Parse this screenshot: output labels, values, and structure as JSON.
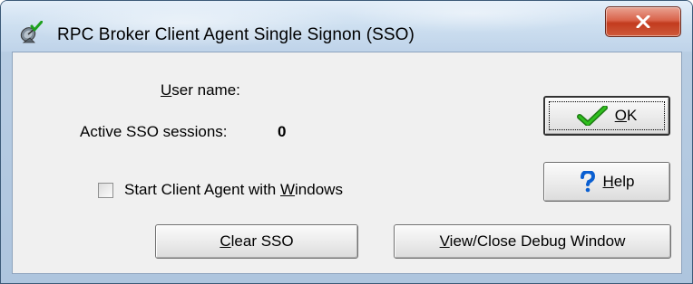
{
  "window": {
    "title": "RPC Broker Client Agent Single Signon (SSO)",
    "close_label": "x",
    "accent_close": "#c8432a"
  },
  "labels": {
    "user_name_prefix": "",
    "user_name_mnemonic": "U",
    "user_name_rest": "ser name:",
    "active_sessions": "Active SSO sessions:",
    "active_sessions_count": "0"
  },
  "checkbox": {
    "label_prefix": "Start Client Agent with ",
    "label_mnemonic": "W",
    "label_rest": "indows",
    "checked": false
  },
  "buttons": {
    "ok": {
      "prefix": "",
      "mnemonic": "O",
      "rest": "K",
      "icon": "green-checkmark-icon"
    },
    "help": {
      "prefix": "",
      "mnemonic": "H",
      "rest": "elp",
      "icon": "blue-question-mark-icon"
    },
    "clear_sso": {
      "prefix": "",
      "mnemonic": "C",
      "rest": "lear SSO"
    },
    "debug": {
      "prefix": "",
      "mnemonic": "V",
      "rest": "iew/Close Debug Window"
    }
  }
}
